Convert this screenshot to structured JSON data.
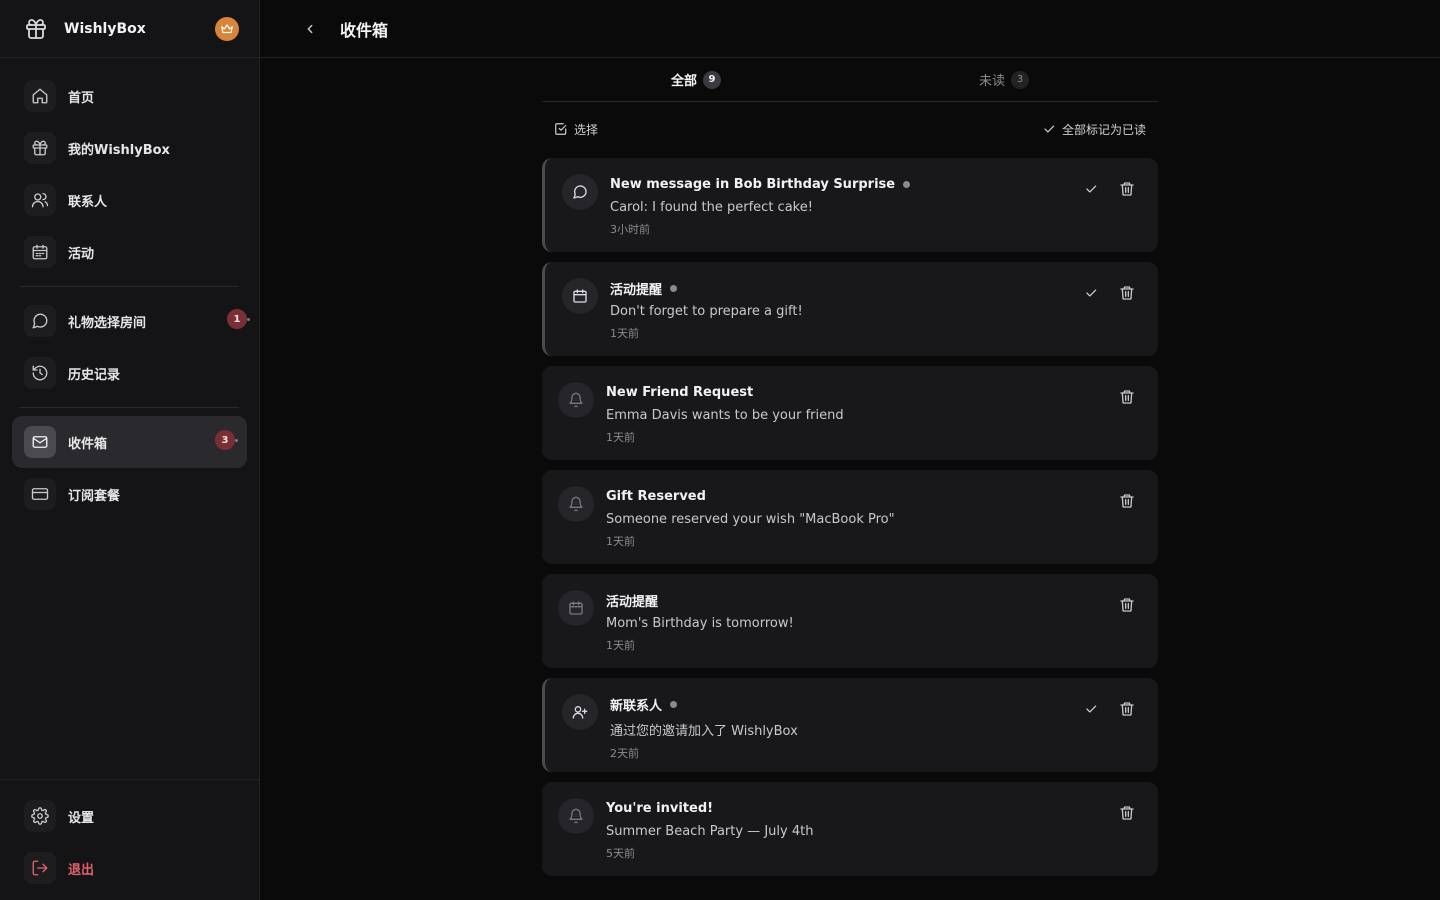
{
  "app": {
    "name": "WishlyBox"
  },
  "sidebar": {
    "items": [
      {
        "label": "首页"
      },
      {
        "label": "我的WishlyBox"
      },
      {
        "label": "联系人"
      },
      {
        "label": "活动"
      },
      {
        "label": "礼物选择房间",
        "badge": "1"
      },
      {
        "label": "历史记录"
      },
      {
        "label": "收件箱",
        "badge": "3"
      },
      {
        "label": "订阅套餐"
      }
    ],
    "bottom": [
      {
        "label": "设置"
      },
      {
        "label": "退出"
      }
    ]
  },
  "header": {
    "title": "收件箱"
  },
  "tabs": [
    {
      "label": "全部",
      "count": "9"
    },
    {
      "label": "未读",
      "count": "3"
    }
  ],
  "toolbar": {
    "select_label": "选择",
    "mark_all_label": "全部标记为已读"
  },
  "notifications": [
    {
      "icon": "chat-bubble-icon",
      "title": "New message in Bob Birthday Surprise",
      "message": "Carol: I found the perfect cake!",
      "time": "3小时前",
      "unread": true
    },
    {
      "icon": "calendar-icon",
      "title": "活动提醒",
      "message": "Don't forget to prepare a gift!",
      "time": "1天前",
      "unread": true
    },
    {
      "icon": "bell-icon",
      "title": "New Friend Request",
      "message": "Emma Davis wants to be your friend",
      "time": "1天前",
      "unread": false
    },
    {
      "icon": "bell-icon",
      "title": "Gift Reserved",
      "message": "Someone reserved your wish \"MacBook Pro\"",
      "time": "1天前",
      "unread": false
    },
    {
      "icon": "calendar-icon",
      "title": "活动提醒",
      "message": "Mom's Birthday is tomorrow!",
      "time": "1天前",
      "unread": false
    },
    {
      "icon": "user-plus-icon",
      "title": "新联系人",
      "message": "通过您的邀请加入了 WishlyBox",
      "time": "2天前",
      "unread": true
    },
    {
      "icon": "bell-icon",
      "title": "You're invited!",
      "message": "Summer Beach Party — July 4th",
      "time": "5天前",
      "unread": false
    }
  ],
  "colors": {
    "accent_badge": "#7a2f35",
    "crown": "#d6853a",
    "logout": "#e0626a"
  }
}
